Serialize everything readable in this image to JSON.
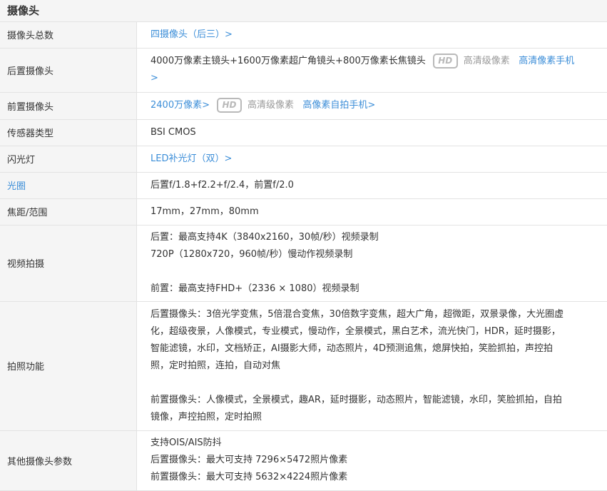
{
  "section": {
    "title": "摄像头"
  },
  "rows": {
    "total": {
      "label": "摄像头总数",
      "value": "四摄像头（后三）>"
    },
    "rear": {
      "label": "后置摄像头",
      "value": "4000万像素主镜头+1600万像素超广角镜头+800万像素长焦镜头",
      "badge": "HD",
      "badge_text": "高清级像素",
      "link": "高清像素手机",
      "arrow": ">"
    },
    "front": {
      "label": "前置摄像头",
      "value": "2400万像素>",
      "badge": "HD",
      "badge_text": "高清级像素",
      "link": "高像素自拍手机>"
    },
    "sensor": {
      "label": "传感器类型",
      "value": "BSI CMOS"
    },
    "flash": {
      "label": "闪光灯",
      "value": "LED补光灯（双）>"
    },
    "aperture": {
      "label": "光圈",
      "value": "后置f/1.8+f2.2+f/2.4，前置f/2.0"
    },
    "focal": {
      "label": "焦距/范围",
      "value": "17mm，27mm，80mm"
    },
    "video": {
      "label": "视频拍摄",
      "line1": "后置：最高支持4K（3840x2160，30帧/秒）视频录制",
      "line2": "720P（1280x720，960帧/秒）慢动作视频录制",
      "line3": "前置：最高支持FHD+（2336 × 1080）视频录制"
    },
    "photo": {
      "label": "拍照功能",
      "rear_lines": [
        "后置摄像头：3倍光学变焦，5倍混合变焦，30倍数字变焦，超大广角，超微距，双景录像，大光圈虚",
        "化，超级夜景，人像模式，专业模式，慢动作，全景模式，黑白艺术，流光快门，HDR，延时摄影，",
        "智能滤镜，水印，文档矫正，AI摄影大师，动态照片，4D预测追焦，熄屏快拍，笑脸抓拍，声控拍",
        "照，定时拍照，连拍，自动对焦"
      ],
      "front_lines": [
        "前置摄像头：人像模式，全景模式，趣AR，延时摄影，动态照片，智能滤镜，水印，笑脸抓拍，自拍",
        "镜像，声控拍照，定时拍照"
      ]
    },
    "other": {
      "label": "其他摄像头参数",
      "line1": "支持OIS/AIS防抖",
      "line2": "后置摄像头：最大可支持 7296×5472照片像素",
      "line3": "前置摄像头：最大可支持 5632×4224照片像素"
    }
  }
}
